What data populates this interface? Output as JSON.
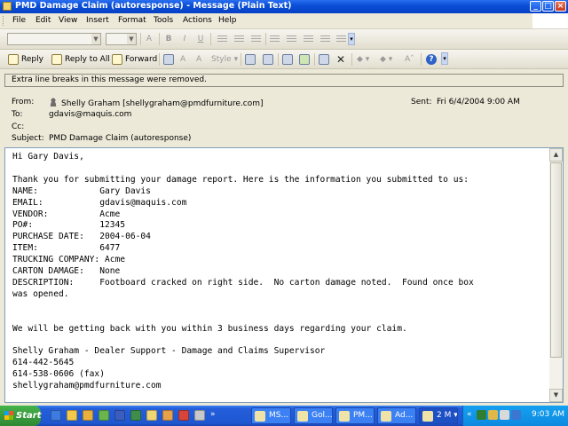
{
  "window": {
    "title": "PMD Damage Claim (autoresponse) - Message (Plain Text)",
    "minimize": "_",
    "maximize": "□",
    "close": "×"
  },
  "menu": [
    "File",
    "Edit",
    "View",
    "Insert",
    "Format",
    "Tools",
    "Actions",
    "Help"
  ],
  "toolbar": {
    "reply": "Reply",
    "reply_all": "Reply to All",
    "forward": "Forward",
    "style": "Style"
  },
  "infobar": "Extra line breaks in this message were removed.",
  "header": {
    "from_label": "From:",
    "from": "Shelly Graham [shellygraham@pmdfurniture.com]",
    "to_label": "To:",
    "to": "gdavis@maquis.com",
    "cc_label": "Cc:",
    "cc": "",
    "subject_label": "Subject:",
    "subject": "PMD Damage Claim (autoresponse)",
    "sent_label": "Sent:",
    "sent": "Fri 6/4/2004 9:00 AM"
  },
  "body": "Hi Gary Davis,\n\nThank you for submitting your damage report. Here is the information you submitted to us:\nNAME:            Gary Davis\nEMAIL:           gdavis@maquis.com\nVENDOR:          Acme\nPO#:             12345\nPURCHASE DATE:   2004-06-04\nITEM:            6477\nTRUCKING COMPANY: Acme\nCARTON DAMAGE:   None\nDESCRIPTION:     Footboard cracked on right side.  No carton damage noted.  Found once box\nwas opened.\n\n\nWe will be getting back with you within 3 business days regarding your claim.\n\nShelly Graham - Dealer Support - Damage and Claims Supervisor\n614-442-5645\n614-538-0606 (fax)\nshellygraham@pmdfurniture.com",
  "taskbar": {
    "start": "Start",
    "tasks": [
      "MS...",
      "Gol...",
      "PM...",
      "Ad..."
    ],
    "group": "2 M",
    "clock": "9:03 AM"
  }
}
